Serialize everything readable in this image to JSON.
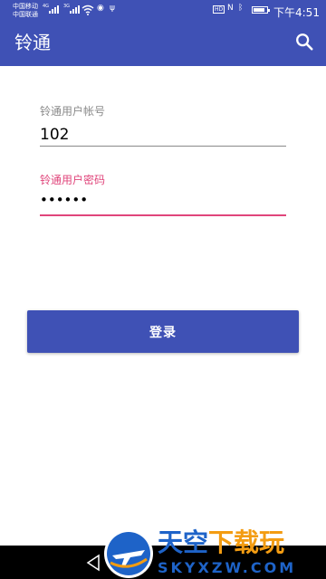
{
  "status_bar": {
    "carrier_1": "中国移动",
    "carrier_2": "中国联通",
    "net_1": "4G",
    "net_2": "3G",
    "hd_badge": "HD",
    "time": "下午4:51"
  },
  "app_bar": {
    "title": "铃通",
    "search_icon": "search-icon"
  },
  "form": {
    "account": {
      "label": "铃通用户帐号",
      "value": "102"
    },
    "password": {
      "label": "铃通用户密码",
      "value": "••••••"
    }
  },
  "login_button": {
    "label": "登录"
  },
  "watermark": {
    "title_part1": "天空",
    "title_part2": "下载玩",
    "domain": "SKYXZW.COM"
  },
  "colors": {
    "primary": "#3f51b5",
    "accent": "#e0457b",
    "label_gray": "#8a8a8a"
  }
}
